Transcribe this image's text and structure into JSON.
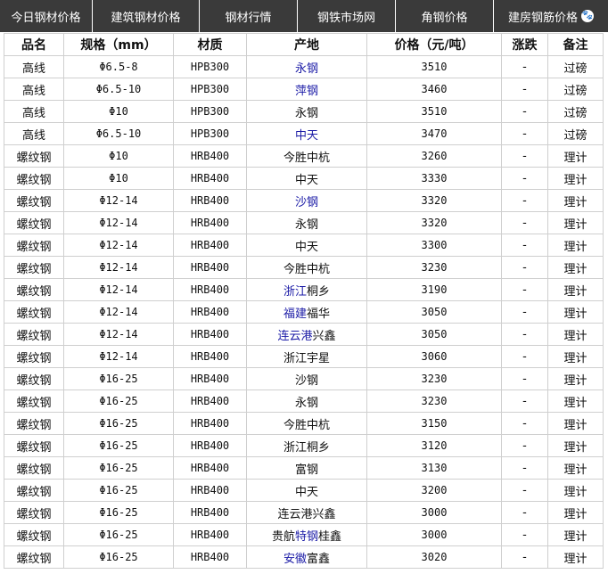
{
  "tabs": [
    {
      "label": "今日钢材价格"
    },
    {
      "label": "建筑钢材价格"
    },
    {
      "label": "钢材行情"
    },
    {
      "label": "钢铁市场网"
    },
    {
      "label": "角钢价格"
    },
    {
      "label": "建房钢筋价格"
    }
  ],
  "table": {
    "headers": [
      "品名",
      "规格（mm）",
      "材质",
      "产地",
      "价格（元/吨）",
      "涨跌",
      "备注"
    ],
    "rows": [
      {
        "name": "高线",
        "spec": "Φ6.5-8",
        "material": "HPB300",
        "origin": "永钢",
        "origin_link": "永钢",
        "price": "3510",
        "change": "-",
        "note": "过磅"
      },
      {
        "name": "高线",
        "spec": "Φ6.5-10",
        "material": "HPB300",
        "origin": "萍钢",
        "origin_link": "萍钢",
        "price": "3460",
        "change": "-",
        "note": "过磅"
      },
      {
        "name": "高线",
        "spec": "Φ10",
        "material": "HPB300",
        "origin": "永钢",
        "origin_link": "",
        "price": "3510",
        "change": "-",
        "note": "过磅"
      },
      {
        "name": "高线",
        "spec": "Φ6.5-10",
        "material": "HPB300",
        "origin": "中天",
        "origin_link": "中天",
        "price": "3470",
        "change": "-",
        "note": "过磅"
      },
      {
        "name": "螺纹钢",
        "spec": "Φ10",
        "material": "HRB400",
        "origin": "今胜中杭",
        "origin_link": "",
        "price": "3260",
        "change": "-",
        "note": "理计"
      },
      {
        "name": "螺纹钢",
        "spec": "Φ10",
        "material": "HRB400",
        "origin": "中天",
        "origin_link": "",
        "price": "3330",
        "change": "-",
        "note": "理计"
      },
      {
        "name": "螺纹钢",
        "spec": "Φ12-14",
        "material": "HRB400",
        "origin": "沙钢",
        "origin_link": "沙钢",
        "price": "3320",
        "change": "-",
        "note": "理计"
      },
      {
        "name": "螺纹钢",
        "spec": "Φ12-14",
        "material": "HRB400",
        "origin": "永钢",
        "origin_link": "",
        "price": "3320",
        "change": "-",
        "note": "理计"
      },
      {
        "name": "螺纹钢",
        "spec": "Φ12-14",
        "material": "HRB400",
        "origin": "中天",
        "origin_link": "",
        "price": "3300",
        "change": "-",
        "note": "理计"
      },
      {
        "name": "螺纹钢",
        "spec": "Φ12-14",
        "material": "HRB400",
        "origin": "今胜中杭",
        "origin_link": "",
        "price": "3230",
        "change": "-",
        "note": "理计"
      },
      {
        "name": "螺纹钢",
        "spec": "Φ12-14",
        "material": "HRB400",
        "origin": "浙江桐乡",
        "origin_link": "浙江",
        "price": "3190",
        "change": "-",
        "note": "理计"
      },
      {
        "name": "螺纹钢",
        "spec": "Φ12-14",
        "material": "HRB400",
        "origin": "福建福华",
        "origin_link": "福建",
        "price": "3050",
        "change": "-",
        "note": "理计"
      },
      {
        "name": "螺纹钢",
        "spec": "Φ12-14",
        "material": "HRB400",
        "origin": "连云港兴鑫",
        "origin_link": "连云港",
        "price": "3050",
        "change": "-",
        "note": "理计"
      },
      {
        "name": "螺纹钢",
        "spec": "Φ12-14",
        "material": "HRB400",
        "origin": "浙江宇星",
        "origin_link": "",
        "price": "3060",
        "change": "-",
        "note": "理计"
      },
      {
        "name": "螺纹钢",
        "spec": "Φ16-25",
        "material": "HRB400",
        "origin": "沙钢",
        "origin_link": "",
        "price": "3230",
        "change": "-",
        "note": "理计"
      },
      {
        "name": "螺纹钢",
        "spec": "Φ16-25",
        "material": "HRB400",
        "origin": "永钢",
        "origin_link": "",
        "price": "3230",
        "change": "-",
        "note": "理计"
      },
      {
        "name": "螺纹钢",
        "spec": "Φ16-25",
        "material": "HRB400",
        "origin": "今胜中杭",
        "origin_link": "",
        "price": "3150",
        "change": "-",
        "note": "理计"
      },
      {
        "name": "螺纹钢",
        "spec": "Φ16-25",
        "material": "HRB400",
        "origin": "浙江桐乡",
        "origin_link": "",
        "price": "3120",
        "change": "-",
        "note": "理计"
      },
      {
        "name": "螺纹钢",
        "spec": "Φ16-25",
        "material": "HRB400",
        "origin": "富钢",
        "origin_link": "",
        "price": "3130",
        "change": "-",
        "note": "理计"
      },
      {
        "name": "螺纹钢",
        "spec": "Φ16-25",
        "material": "HRB400",
        "origin": "中天",
        "origin_link": "",
        "price": "3200",
        "change": "-",
        "note": "理计"
      },
      {
        "name": "螺纹钢",
        "spec": "Φ16-25",
        "material": "HRB400",
        "origin": "连云港兴鑫",
        "origin_link": "",
        "price": "3000",
        "change": "-",
        "note": "理计"
      },
      {
        "name": "螺纹钢",
        "spec": "Φ16-25",
        "material": "HRB400",
        "origin": "贵航特钢桂鑫",
        "origin_link": "特钢",
        "price": "3000",
        "change": "-",
        "note": "理计"
      },
      {
        "name": "螺纹钢",
        "spec": "Φ16-25",
        "material": "HRB400",
        "origin": "安徽富鑫",
        "origin_link": "安徽",
        "price": "3020",
        "change": "-",
        "note": "理计"
      }
    ]
  },
  "colors": {
    "tab_bg": "#3a3a3a",
    "link": "#1a1aa6",
    "border": "#cfcfcf"
  }
}
